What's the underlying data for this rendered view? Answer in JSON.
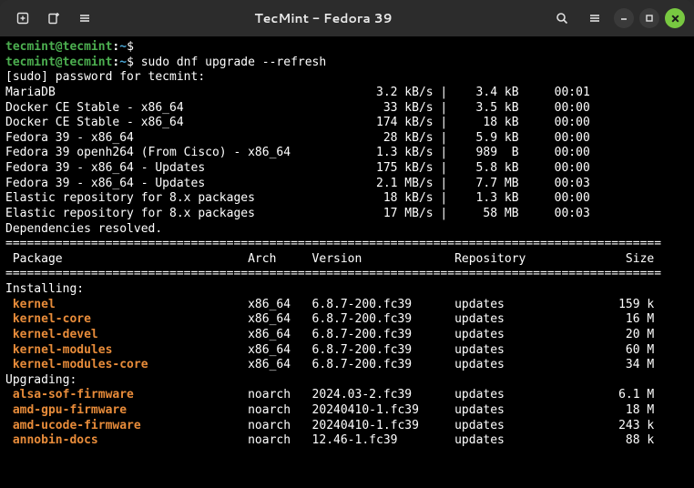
{
  "titlebar": {
    "title": "TecMint - Fedora 39"
  },
  "prompt": {
    "user": "tecmint",
    "host": "tecmint",
    "path": "~",
    "sep": "@",
    "end": "$"
  },
  "command": "sudo dnf upgrade --refresh",
  "sudo_line": "[sudo] password for tecmint:",
  "repos": [
    {
      "name": "MariaDB",
      "rate": "3.2 kB/s",
      "size": "3.4 kB",
      "eta": "00:01"
    },
    {
      "name": "Docker CE Stable - x86_64",
      "rate": "33 kB/s",
      "size": "3.5 kB",
      "eta": "00:00"
    },
    {
      "name": "Docker CE Stable - x86_64",
      "rate": "174 kB/s",
      "size": "18 kB",
      "eta": "00:00"
    },
    {
      "name": "Fedora 39 - x86_64",
      "rate": "28 kB/s",
      "size": "5.9 kB",
      "eta": "00:00"
    },
    {
      "name": "Fedora 39 openh264 (From Cisco) - x86_64",
      "rate": "1.3 kB/s",
      "size": "989  B",
      "eta": "00:00"
    },
    {
      "name": "Fedora 39 - x86_64 - Updates",
      "rate": "175 kB/s",
      "size": "5.8 kB",
      "eta": "00:00"
    },
    {
      "name": "Fedora 39 - x86_64 - Updates",
      "rate": "2.1 MB/s",
      "size": "7.7 MB",
      "eta": "00:03"
    },
    {
      "name": "Elastic repository for 8.x packages",
      "rate": "18 kB/s",
      "size": "1.3 kB",
      "eta": "00:00"
    },
    {
      "name": "Elastic repository for 8.x packages",
      "rate": "17 MB/s",
      "size": "58 MB",
      "eta": "00:03"
    }
  ],
  "deps_line": "Dependencies resolved.",
  "header": {
    "package": "Package",
    "arch": "Arch",
    "version": "Version",
    "repo": "Repository",
    "size": "Size"
  },
  "sections": {
    "installing": "Installing:",
    "upgrading": "Upgrading:"
  },
  "installing": [
    {
      "pkg": "kernel",
      "arch": "x86_64",
      "ver": "6.8.7-200.fc39",
      "repo": "updates",
      "size": "159 k"
    },
    {
      "pkg": "kernel-core",
      "arch": "x86_64",
      "ver": "6.8.7-200.fc39",
      "repo": "updates",
      "size": "16 M"
    },
    {
      "pkg": "kernel-devel",
      "arch": "x86_64",
      "ver": "6.8.7-200.fc39",
      "repo": "updates",
      "size": "20 M"
    },
    {
      "pkg": "kernel-modules",
      "arch": "x86_64",
      "ver": "6.8.7-200.fc39",
      "repo": "updates",
      "size": "60 M"
    },
    {
      "pkg": "kernel-modules-core",
      "arch": "x86_64",
      "ver": "6.8.7-200.fc39",
      "repo": "updates",
      "size": "34 M"
    }
  ],
  "upgrading": [
    {
      "pkg": "alsa-sof-firmware",
      "arch": "noarch",
      "ver": "2024.03-2.fc39",
      "repo": "updates",
      "size": "6.1 M"
    },
    {
      "pkg": "amd-gpu-firmware",
      "arch": "noarch",
      "ver": "20240410-1.fc39",
      "repo": "updates",
      "size": "18 M"
    },
    {
      "pkg": "amd-ucode-firmware",
      "arch": "noarch",
      "ver": "20240410-1.fc39",
      "repo": "updates",
      "size": "243 k"
    },
    {
      "pkg": "annobin-docs",
      "arch": "noarch",
      "ver": "12.46-1.fc39",
      "repo": "updates",
      "size": "88 k"
    }
  ],
  "cols": {
    "name": 48,
    "rate": 12,
    "size": 9,
    "eta": 10,
    "pkg_indent": 1,
    "pkg": 33,
    "arch": 9,
    "ver": 20,
    "repo": 16,
    "psize": 7
  },
  "rule_char": "="
}
